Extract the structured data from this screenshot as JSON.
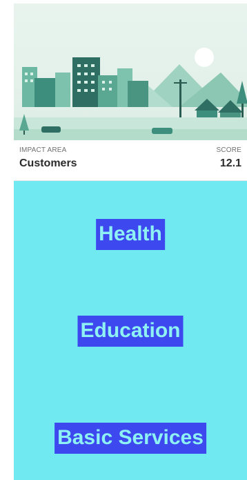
{
  "card": {
    "impact_area_label": "IMPACT AREA",
    "impact_area_value": "Customers",
    "score_label": "SCORE",
    "score_value": "12.1"
  },
  "categories": [
    {
      "label": "Health"
    },
    {
      "label": "Education"
    },
    {
      "label": "Basic Services"
    }
  ],
  "colors": {
    "panel_bg": "#70e9f0",
    "pill_bg": "#3d48ef",
    "pill_text": "#8ef2f4"
  }
}
